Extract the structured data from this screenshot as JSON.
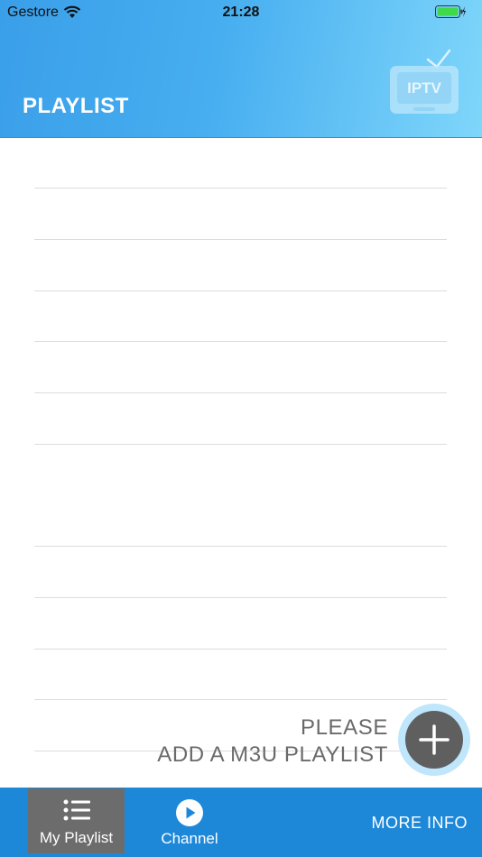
{
  "status_bar": {
    "carrier": "Gestore",
    "time": "21:28"
  },
  "header": {
    "title": "PLAYLIST",
    "logo_text": "IPTV"
  },
  "empty_state": {
    "line1": "PLEASE",
    "line2": "ADD A M3U PLAYLIST"
  },
  "tabbar": {
    "tabs": [
      {
        "label": "My Playlist",
        "icon": "list-icon",
        "active": true
      },
      {
        "label": "Channel",
        "icon": "play-circle-icon",
        "active": false
      }
    ],
    "more_info_label": "MORE INFO"
  },
  "colors": {
    "header_start": "#3a9fe9",
    "header_end": "#7fd6fa",
    "tabbar": "#1e88d8",
    "active_tab": "#6c6c6c",
    "fab": "#5f5f5f"
  }
}
